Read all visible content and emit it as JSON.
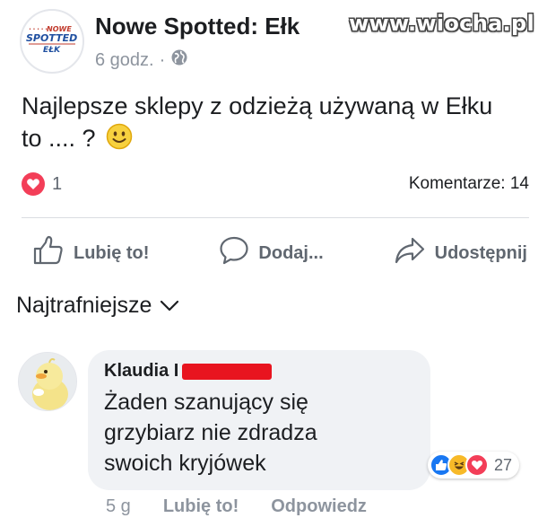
{
  "watermark": "www.wiocha.pl",
  "post": {
    "page_name": "Nowe Spotted: Ełk",
    "avatar_logo": {
      "line1": "NOWE",
      "line2": "SPOTTED",
      "line3": "EŁK"
    },
    "time": "6 godz.",
    "dot": "·",
    "text_line1": "Najlepsze sklepy z odzieżą używaną w Ełku",
    "text_line2": "to .... ?",
    "reaction_count": "1",
    "comments_label": "Komentarze: 14"
  },
  "actions": {
    "like": "Lubię to!",
    "comment": "Dodaj...",
    "share": "Udostępnij"
  },
  "sort_label": "Najtrafniejsze",
  "comment": {
    "author": "Klaudia I",
    "text_line1": "Żaden szanujący się",
    "text_line2": "grzybiarz nie zdradza",
    "text_line3": "swoich kryjówek",
    "reaction_count": "27",
    "time": "5 g",
    "like_label": "Lubię to!",
    "reply_label": "Odpowiedz"
  },
  "colors": {
    "heart": "#f33e58",
    "like_blue": "#1877f2",
    "haha_yellow": "#f7b928",
    "redaction": "#e8141f"
  }
}
